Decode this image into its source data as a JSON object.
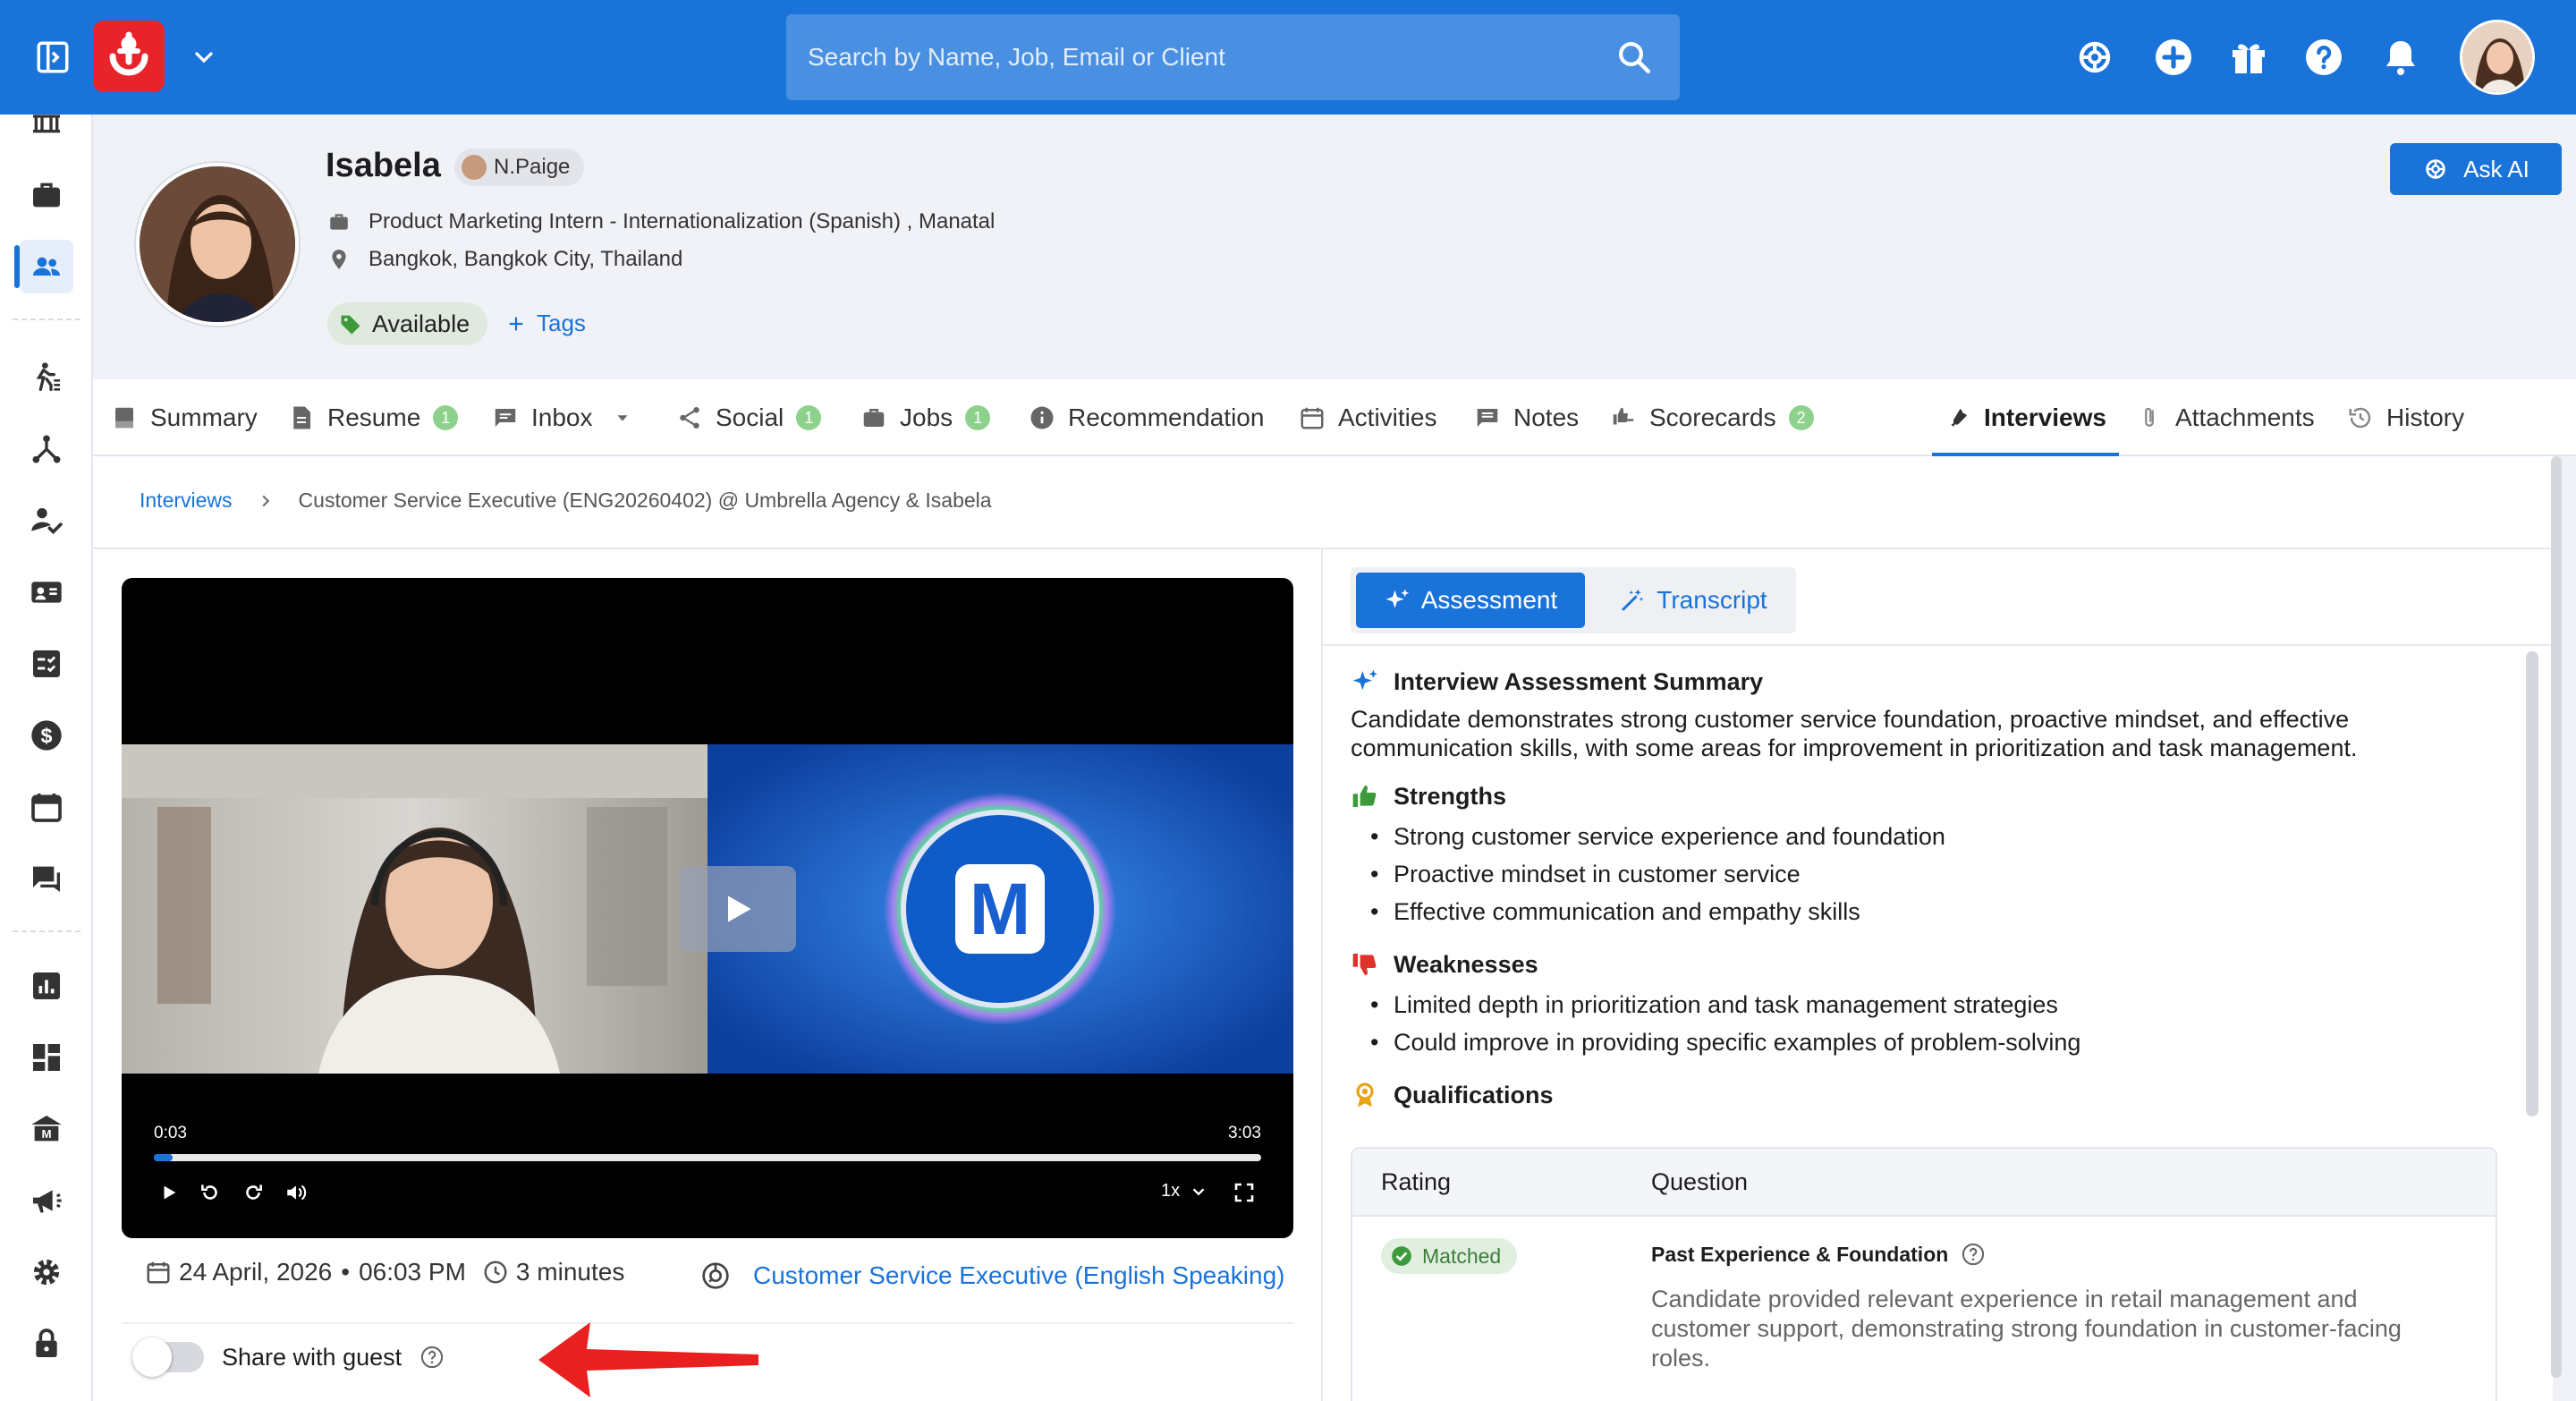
{
  "topbar": {
    "search_placeholder": "Search by Name, Job, Email or Client"
  },
  "candidate": {
    "name": "Isabela",
    "owner": "N.Paige",
    "job": "Product Marketing Intern - Internationalization (Spanish) , Manatal",
    "location": "Bangkok, Bangkok City, Thailand",
    "status": "Available",
    "tags_label": "Tags"
  },
  "actions": {
    "ask_ai": "Ask AI"
  },
  "tabs": [
    {
      "label": "Summary"
    },
    {
      "label": "Resume",
      "count": "1"
    },
    {
      "label": "Inbox"
    },
    {
      "label": "Social",
      "count": "1"
    },
    {
      "label": "Jobs",
      "count": "1"
    },
    {
      "label": "Recommendation"
    },
    {
      "label": "Activities"
    },
    {
      "label": "Notes"
    },
    {
      "label": "Scorecards",
      "count": "2"
    },
    {
      "label": "Interviews"
    },
    {
      "label": "Attachments"
    },
    {
      "label": "History"
    }
  ],
  "breadcrumb": {
    "root": "Interviews",
    "current": "Customer Service Executive (ENG20260402) @ Umbrella Agency & Isabela"
  },
  "video": {
    "current_time": "0:03",
    "duration": "3:03",
    "progress": 0.017,
    "speed": "1x"
  },
  "interview_meta": {
    "date": "24 April, 2026",
    "time": "06:03 PM",
    "length": "3 minutes",
    "template": "Customer Service Executive (English Speaking)",
    "share_label": "Share with guest",
    "share_enabled": false
  },
  "assessment_tabs": {
    "assessment": "Assessment",
    "transcript": "Transcript"
  },
  "assessment": {
    "summary_title": "Interview Assessment Summary",
    "summary_text": "Candidate demonstrates strong customer service foundation, proactive mindset, and effective communication skills, with some areas for improvement in prioritization and task management.",
    "strengths_title": "Strengths",
    "strengths": [
      "Strong customer service experience and foundation",
      "Proactive mindset in customer service",
      "Effective communication and empathy skills"
    ],
    "weaknesses_title": "Weaknesses",
    "weaknesses": [
      "Limited depth in prioritization and task management strategies",
      "Could improve in providing specific examples of problem-solving"
    ],
    "qualifications_title": "Qualifications"
  },
  "qualifications_table": {
    "col_rating": "Rating",
    "col_question": "Question",
    "rows": [
      {
        "rating": "Matched",
        "question": "Past Experience & Foundation",
        "answer": "Candidate provided relevant experience in retail management and customer support, demonstrating strong foundation in customer-facing roles."
      }
    ]
  },
  "colors": {
    "brand": "#1a73d9",
    "logo": "#e8232a",
    "success": "#3d7d3a"
  }
}
